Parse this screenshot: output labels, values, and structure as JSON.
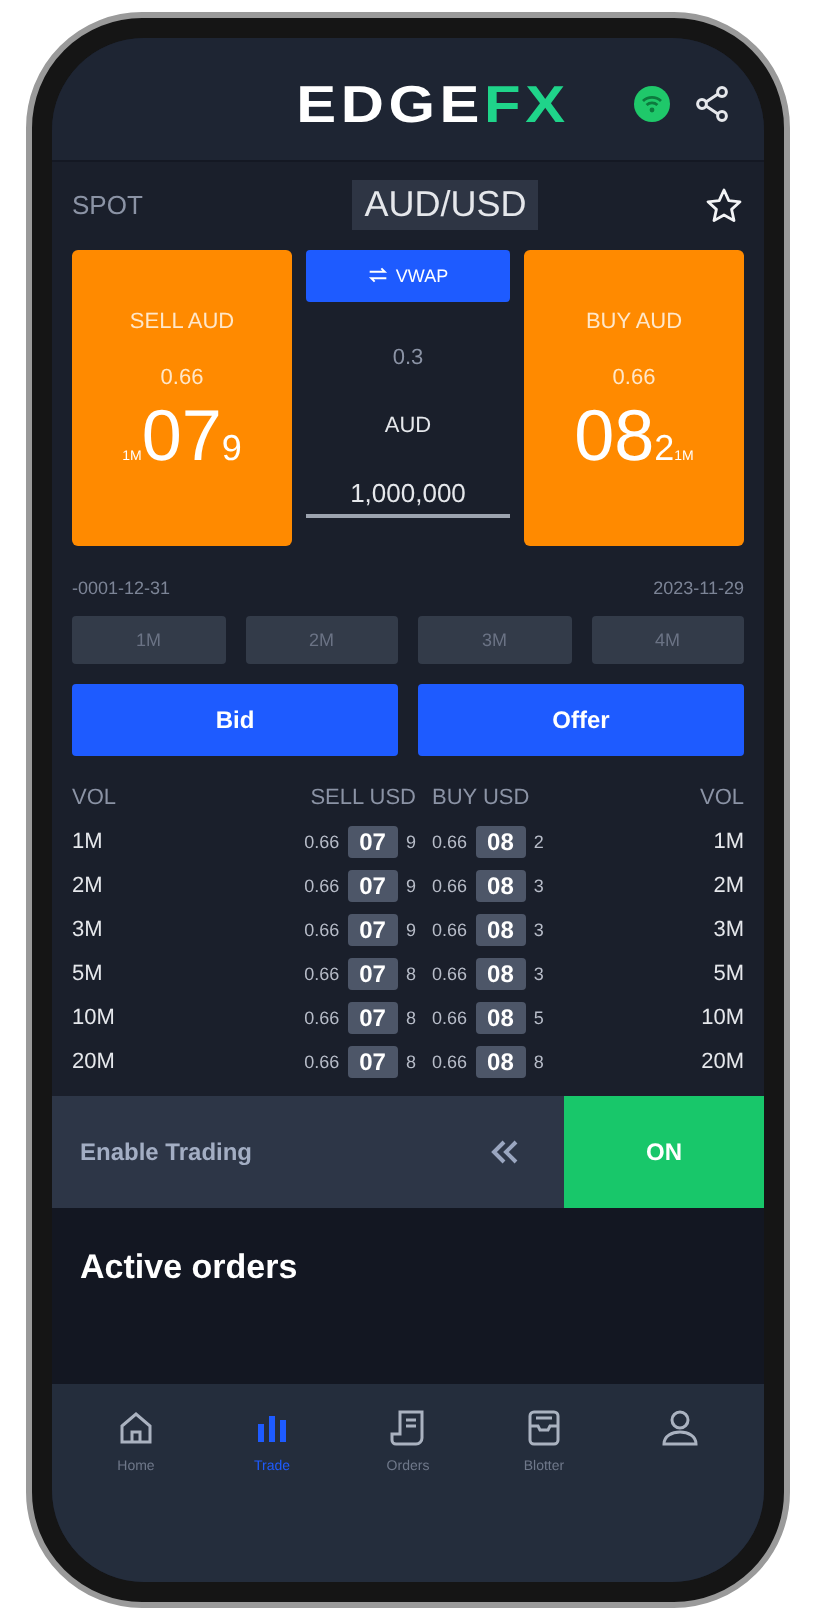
{
  "header": {
    "logo_main": "EDGE",
    "logo_accent": "FX",
    "connected": true
  },
  "instrument": {
    "product": "SPOT",
    "pair": "AUD/USD",
    "favorite": false
  },
  "sell_tile": {
    "label": "SELL AUD",
    "big_figure": "0.66",
    "pips": "07",
    "last": "9",
    "tenor": "1M"
  },
  "center": {
    "mode_button": "VWAP",
    "spread": "0.3",
    "currency": "AUD",
    "amount": "1,000,000"
  },
  "buy_tile": {
    "label": "BUY AUD",
    "big_figure": "0.66",
    "pips": "08",
    "last": "2",
    "tenor": "1M"
  },
  "dates": {
    "near": "-0001-12-31",
    "far": "2023-11-29"
  },
  "tenors": [
    "1M",
    "2M",
    "3M",
    "4M"
  ],
  "actions": [
    "Bid",
    "Offer"
  ],
  "ladder": {
    "columns": [
      "VOL",
      "SELL USD",
      "BUY USD",
      "VOL"
    ],
    "rows": [
      {
        "vol": "1M",
        "sell_big": "0.66",
        "sell_pips": "07",
        "sell_last": "9",
        "buy_big": "0.66",
        "buy_pips": "08",
        "buy_last": "2",
        "vol_right": "1M"
      },
      {
        "vol": "2M",
        "sell_big": "0.66",
        "sell_pips": "07",
        "sell_last": "9",
        "buy_big": "0.66",
        "buy_pips": "08",
        "buy_last": "3",
        "vol_right": "2M"
      },
      {
        "vol": "3M",
        "sell_big": "0.66",
        "sell_pips": "07",
        "sell_last": "9",
        "buy_big": "0.66",
        "buy_pips": "08",
        "buy_last": "3",
        "vol_right": "3M"
      },
      {
        "vol": "5M",
        "sell_big": "0.66",
        "sell_pips": "07",
        "sell_last": "8",
        "buy_big": "0.66",
        "buy_pips": "08",
        "buy_last": "3",
        "vol_right": "5M"
      },
      {
        "vol": "10M",
        "sell_big": "0.66",
        "sell_pips": "07",
        "sell_last": "8",
        "buy_big": "0.66",
        "buy_pips": "08",
        "buy_last": "5",
        "vol_right": "10M"
      },
      {
        "vol": "20M",
        "sell_big": "0.66",
        "sell_pips": "07",
        "sell_last": "8",
        "buy_big": "0.66",
        "buy_pips": "08",
        "buy_last": "8",
        "vol_right": "20M"
      }
    ]
  },
  "trading": {
    "label": "Enable Trading",
    "toggle": "ON",
    "on": true
  },
  "active_orders": {
    "title": "Active orders"
  },
  "nav": [
    {
      "kind": "home",
      "label": "Home",
      "selected": false
    },
    {
      "kind": "trade",
      "label": "Trade",
      "selected": true
    },
    {
      "kind": "orders",
      "label": "Orders",
      "selected": false
    },
    {
      "kind": "blotter",
      "label": "Blotter",
      "selected": false
    },
    {
      "kind": "profile",
      "selected": false
    }
  ]
}
